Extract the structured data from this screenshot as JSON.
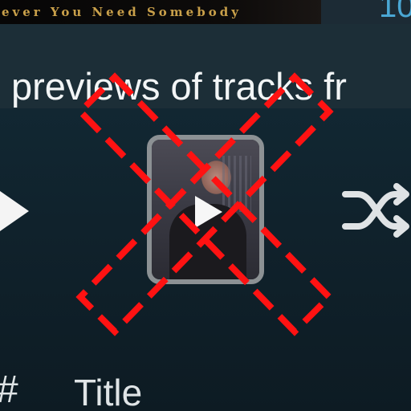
{
  "header": {
    "album_banner_text": "ever You Need Somebody",
    "right_number": "10"
  },
  "banner": {
    "text": "previews of tracks fr"
  },
  "controls": {
    "play_icon": "play-icon",
    "thumbnail_play_icon": "play-icon",
    "shuffle_icon": "shuffle-icon",
    "disabled_overlay_icon": "dashed-x-icon",
    "overlay_color": "#ff1010"
  },
  "table_header": {
    "number_col": "#",
    "title_col": "Title"
  }
}
